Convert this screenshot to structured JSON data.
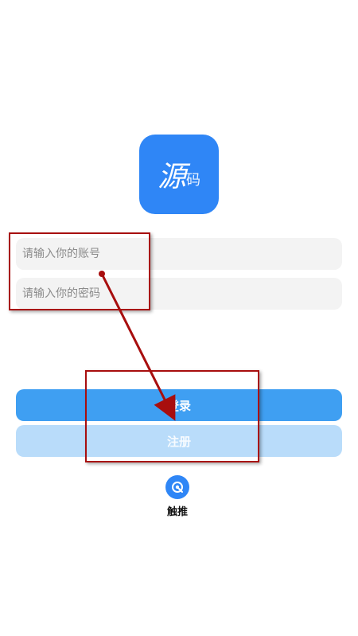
{
  "logo": {
    "main": "源",
    "code": "码"
  },
  "login_form": {
    "account_placeholder": "请输入你的账号",
    "password_placeholder": "请输入你的密码"
  },
  "buttons": {
    "login": "登录",
    "register": "注册"
  },
  "touch": {
    "label": "触推",
    "icon": "touch-push-icon"
  },
  "colors": {
    "brand": "#2f86f6",
    "login_button": "#3f9ff2",
    "register_button": "#b9dcfa",
    "annotation": "#a80e0e"
  }
}
